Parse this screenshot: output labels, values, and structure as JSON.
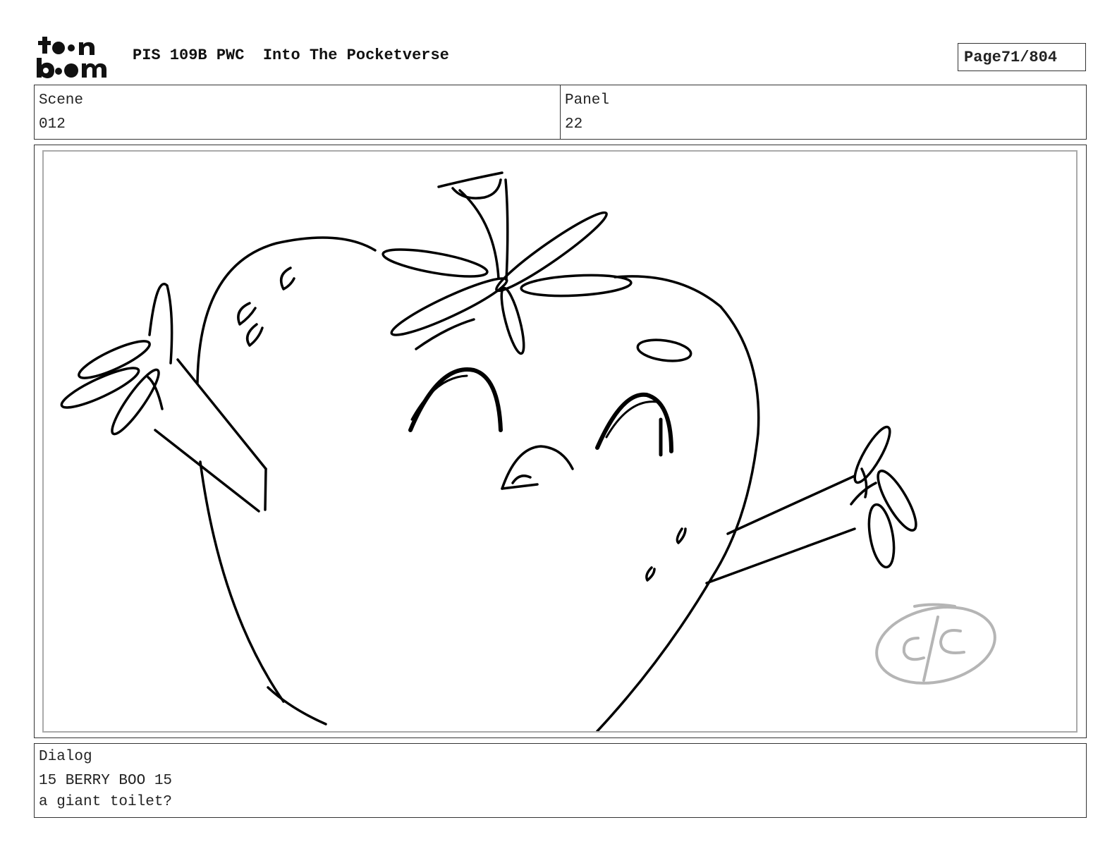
{
  "header": {
    "logo_text": "toon boom",
    "production": "PIS 109B PWC",
    "episode_title": "Into The Pocketverse",
    "page_label": "Page",
    "page_value": "71/804"
  },
  "info": {
    "scene_label": "Scene",
    "scene_value": "012",
    "panel_label": "Panel",
    "panel_value": "22"
  },
  "drawing": {
    "description_icon": "strawberry-character-sketch",
    "signature_text": "c/c",
    "stroke_color": "#000000",
    "signature_color": "#b5b5b5"
  },
  "dialog": {
    "label": "Dialog",
    "line1": "15 BERRY BOO 15",
    "line2": "a giant toilet?"
  }
}
